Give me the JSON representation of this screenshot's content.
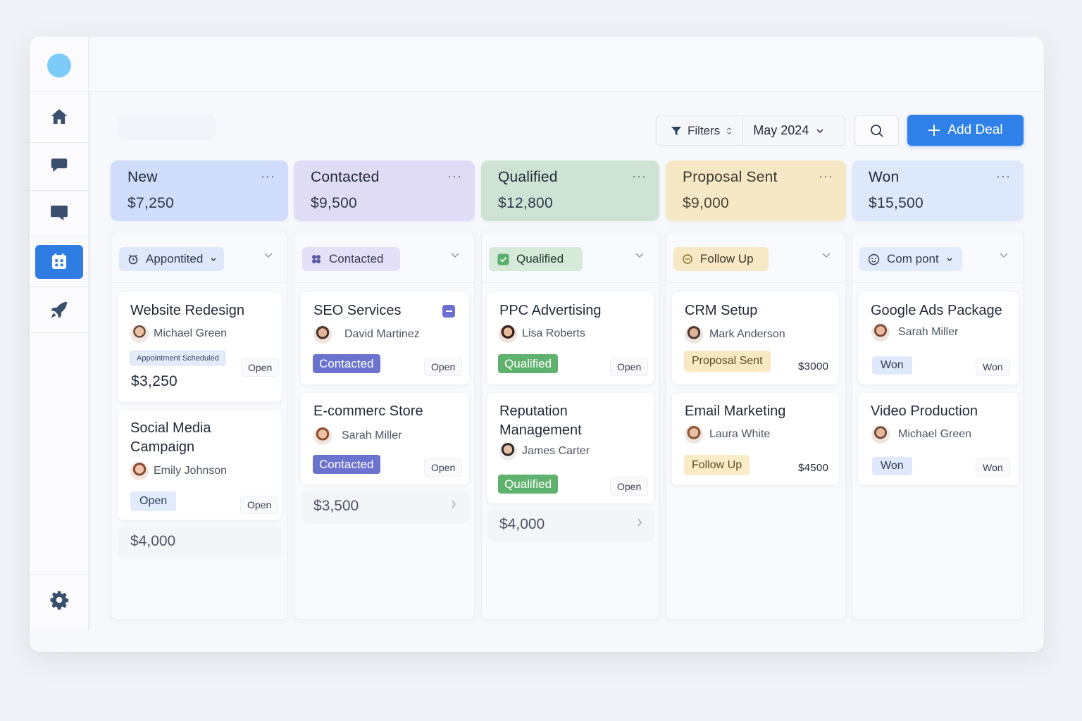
{
  "toolbar": {
    "filters_label": "Filters",
    "month_label": "May 2024",
    "add_deal_label": "Add Deal"
  },
  "sidebar": {
    "items": [
      {
        "icon": "home-icon"
      },
      {
        "icon": "chat-bubble-icon"
      },
      {
        "icon": "message-icon"
      },
      {
        "icon": "calendar-icon",
        "active": true
      },
      {
        "icon": "rocket-icon"
      }
    ],
    "settings_icon": "gear-icon"
  },
  "stages": [
    {
      "name": "New",
      "amount": "$7,250",
      "more": "···",
      "color": "#cfdcfb"
    },
    {
      "name": "Contacted",
      "amount": "$9,500",
      "more": "···",
      "color": "#e1dcf6"
    },
    {
      "name": "Qualified",
      "amount": "$12,800",
      "more": "···",
      "color": "#cfe3d5"
    },
    {
      "name": "Proposal Sent",
      "amount": "$9,000",
      "more": "···",
      "color": "#f6e8c4"
    },
    {
      "name": "Won",
      "amount": "$15,500",
      "more": "···",
      "color": "#dde8fb"
    }
  ],
  "columns": [
    {
      "chip": "Appontited",
      "cards": [
        {
          "title": "Website Redesign",
          "person": "Michael Green",
          "tag": "Appointment Scheduled",
          "status": "Open",
          "price": "$3,250"
        },
        {
          "title": "Social Media Campaign",
          "person": "Emily Johnson",
          "tag": "Open",
          "status": "Open"
        }
      ],
      "summary": "$4,000"
    },
    {
      "chip": "Contacted",
      "cards": [
        {
          "title": "SEO Services",
          "person": "David Martinez",
          "tag": "Contacted",
          "status": "Open"
        },
        {
          "title": "E-commerc Store",
          "person": "Sarah Miller",
          "tag": "Contacted",
          "status": "Open"
        }
      ],
      "summary": "$3,500"
    },
    {
      "chip": "Qualified",
      "cards": [
        {
          "title": "PPC Advertising",
          "person": "Lisa Roberts",
          "tag": "Qualified",
          "status": "Open"
        },
        {
          "title": "Reputation Management",
          "person": "James Carter",
          "tag": "Qualified",
          "status": "Open"
        }
      ],
      "summary": "$4,000"
    },
    {
      "chip": "Follow Up",
      "cards": [
        {
          "title": "CRM Setup",
          "person": "Mark Anderson",
          "tag": "Proposal Sent",
          "status": "$3000"
        },
        {
          "title": "Email Marketing",
          "person": "Laura White",
          "tag": "Follow Up",
          "status": "$4500"
        }
      ]
    },
    {
      "chip": "Com pont",
      "cards": [
        {
          "title": "Google Ads Package",
          "person": "Sarah Miller",
          "tag": "Won",
          "status": "Won"
        },
        {
          "title": "Video Production",
          "person": "Michael Green",
          "tag": "Won",
          "status": "Won"
        }
      ]
    }
  ]
}
